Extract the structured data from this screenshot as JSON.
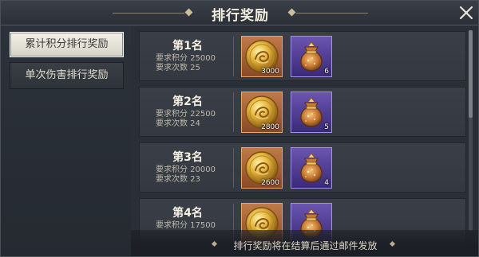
{
  "window": {
    "title": "排行奖励",
    "close_icon": "close-icon"
  },
  "sidebar": {
    "tabs": [
      {
        "label": "累计积分排行奖励",
        "active": true
      },
      {
        "label": "单次伤害排行奖励",
        "active": false
      }
    ]
  },
  "ranks": [
    {
      "title": "第1名",
      "req_score": "要求积分 25000",
      "req_count": "要求次数 25",
      "rewards": [
        {
          "icon": "gold-coin-icon",
          "qty": "3000"
        },
        {
          "icon": "gift-bag-icon",
          "qty": "6"
        }
      ]
    },
    {
      "title": "第2名",
      "req_score": "要求积分 22500",
      "req_count": "要求次数 24",
      "rewards": [
        {
          "icon": "gold-coin-icon",
          "qty": "2800"
        },
        {
          "icon": "gift-bag-icon",
          "qty": "5"
        }
      ]
    },
    {
      "title": "第3名",
      "req_score": "要求积分 20000",
      "req_count": "要求次数 23",
      "rewards": [
        {
          "icon": "gold-coin-icon",
          "qty": "2600"
        },
        {
          "icon": "gift-bag-icon",
          "qty": "4"
        }
      ]
    },
    {
      "title": "第4名",
      "req_score": "要求积分 17500",
      "req_count": "",
      "rewards": [
        {
          "icon": "gold-coin-icon",
          "qty": ""
        },
        {
          "icon": "gift-bag-icon",
          "qty": ""
        }
      ]
    }
  ],
  "footer": {
    "note": "排行奖励将在结算后通过邮件发放"
  },
  "colors": {
    "coin_frame": "#c07a4a",
    "bag_frame": "#6a55b0",
    "active_tab": "#f3f1ea"
  }
}
